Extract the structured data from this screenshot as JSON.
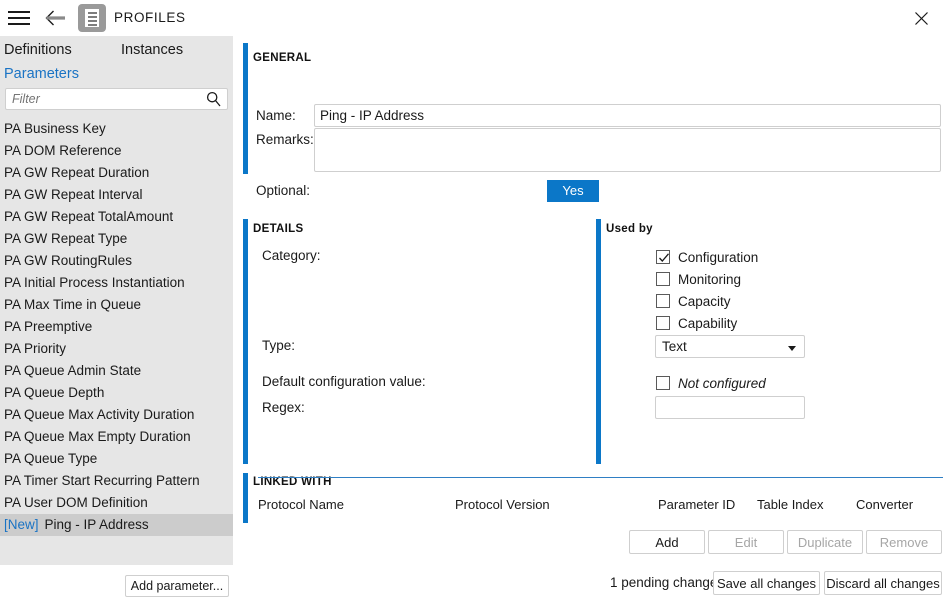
{
  "titlebar": {
    "menu_icon": "hamburger-menu-icon",
    "back_icon": "back-arrow-icon",
    "app_icon": "profiles-document-icon",
    "title": "PROFILES",
    "close_icon": "close-icon"
  },
  "sidebar": {
    "tabs": [
      {
        "label": "Definitions",
        "active": false
      },
      {
        "label": "Instances",
        "active": false
      }
    ],
    "subtab": {
      "label": "Parameters",
      "active": true
    },
    "filter": {
      "value": "",
      "placeholder": "Filter",
      "icon": "search-icon"
    },
    "items": [
      {
        "label": "PA Business Key",
        "tag": "",
        "selected": false
      },
      {
        "label": "PA DOM Reference",
        "tag": "",
        "selected": false
      },
      {
        "label": "PA GW Repeat Duration",
        "tag": "",
        "selected": false
      },
      {
        "label": "PA GW Repeat Interval",
        "tag": "",
        "selected": false
      },
      {
        "label": "PA GW Repeat TotalAmount",
        "tag": "",
        "selected": false
      },
      {
        "label": "PA GW Repeat Type",
        "tag": "",
        "selected": false
      },
      {
        "label": "PA GW RoutingRules",
        "tag": "",
        "selected": false
      },
      {
        "label": "PA Initial Process Instantiation",
        "tag": "",
        "selected": false
      },
      {
        "label": "PA Max Time in Queue",
        "tag": "",
        "selected": false
      },
      {
        "label": "PA Preemptive",
        "tag": "",
        "selected": false
      },
      {
        "label": "PA Priority",
        "tag": "",
        "selected": false
      },
      {
        "label": "PA Queue Admin State",
        "tag": "",
        "selected": false
      },
      {
        "label": "PA Queue Depth",
        "tag": "",
        "selected": false
      },
      {
        "label": "PA Queue Max Activity Duration",
        "tag": "",
        "selected": false
      },
      {
        "label": "PA Queue Max Empty Duration",
        "tag": "",
        "selected": false
      },
      {
        "label": "PA Queue Type",
        "tag": "",
        "selected": false
      },
      {
        "label": "PA Timer Start Recurring Pattern",
        "tag": "",
        "selected": false
      },
      {
        "label": "PA User DOM Definition",
        "tag": "",
        "selected": false
      },
      {
        "label": "Ping - IP Address",
        "tag": "[New]",
        "selected": true
      }
    ],
    "add_parameter_label": "Add parameter..."
  },
  "general": {
    "section_title": "GENERAL",
    "name_label": "Name:",
    "name_value": "Ping - IP Address",
    "remarks_label": "Remarks:",
    "remarks_value": "",
    "optional_label": "Optional:",
    "optional_value": "Yes"
  },
  "details": {
    "section_title": "DETAILS",
    "category_label": "Category:",
    "categories": [
      {
        "label": "Configuration",
        "checked": true
      },
      {
        "label": "Monitoring",
        "checked": false
      },
      {
        "label": "Capacity",
        "checked": false
      },
      {
        "label": "Capability",
        "checked": false
      }
    ],
    "type_label": "Type:",
    "type_value": "Text",
    "default_config_label": "Default configuration value:",
    "default_config_checked": false,
    "default_config_value": "Not configured",
    "regex_label": "Regex:",
    "regex_value": ""
  },
  "used_by": {
    "section_title": "Used by"
  },
  "linked_with": {
    "section_title": "LINKED WITH",
    "columns": [
      "Protocol Name",
      "Protocol Version",
      "Parameter ID",
      "Table Index",
      "Converter"
    ],
    "rows": [],
    "buttons": [
      {
        "label": "Add",
        "disabled": false
      },
      {
        "label": "Edit",
        "disabled": true
      },
      {
        "label": "Duplicate",
        "disabled": true
      },
      {
        "label": "Remove",
        "disabled": true
      }
    ]
  },
  "footer": {
    "pending_text": "1 pending change",
    "save_label": "Save all changes",
    "discard_label": "Discard all changes"
  },
  "colors": {
    "accent": "#0b77c8",
    "link": "#1a73c4",
    "sidebar_bg": "#e6e6e6",
    "selection_bg": "#cccccc"
  }
}
